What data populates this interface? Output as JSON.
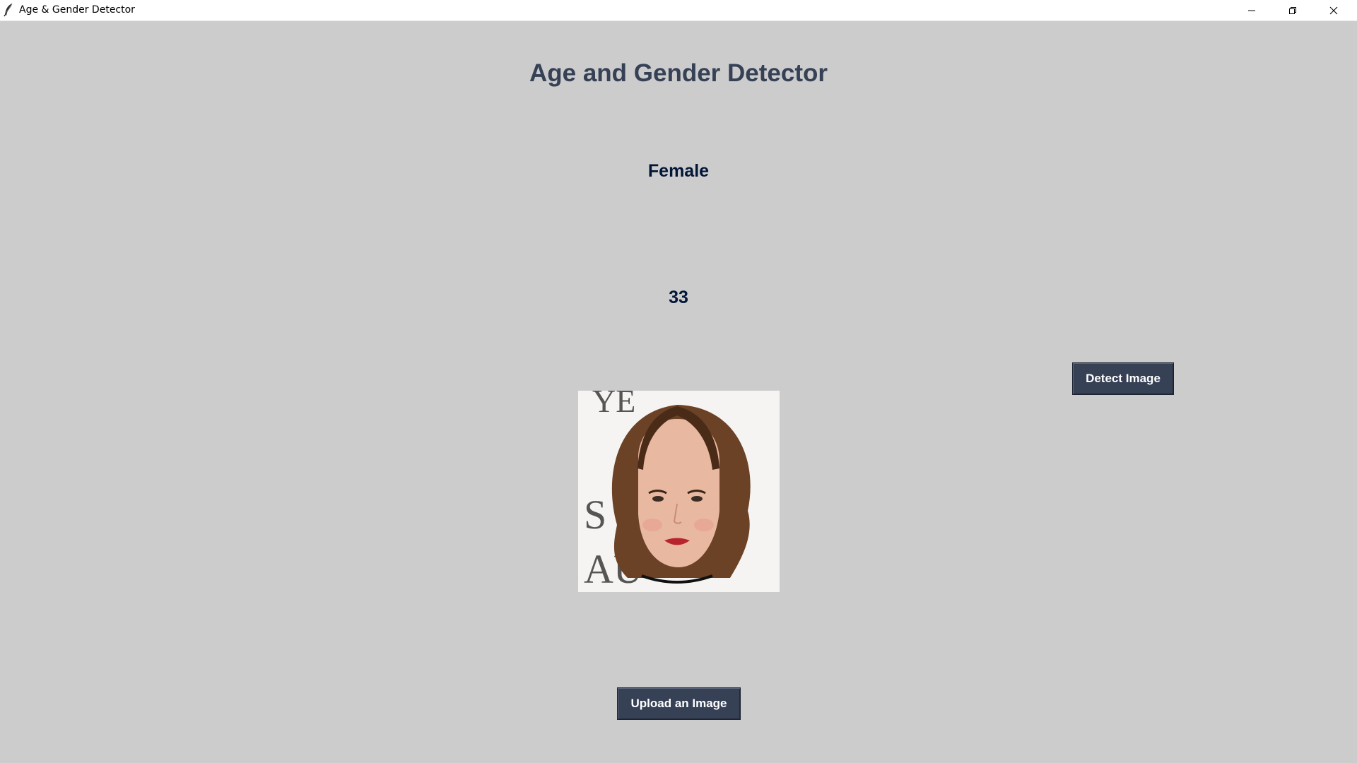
{
  "window": {
    "title": "Age & Gender Detector"
  },
  "app": {
    "heading": "Age and Gender Detector",
    "gender_result": "Female",
    "age_result": "33",
    "detect_button_label": "Detect Image",
    "upload_button_label": "Upload an Image",
    "backdrop_text_top": "YE",
    "backdrop_text_mid": "S",
    "backdrop_text_bot": "AU"
  },
  "icons": {
    "app": "feather-icon",
    "minimize": "minimize-icon",
    "maximize": "restore-icon",
    "close": "close-icon"
  },
  "colors": {
    "background": "#cccccc",
    "heading": "#364156",
    "result_text": "#011638",
    "button_bg": "#364156",
    "button_text": "#ffffff"
  }
}
